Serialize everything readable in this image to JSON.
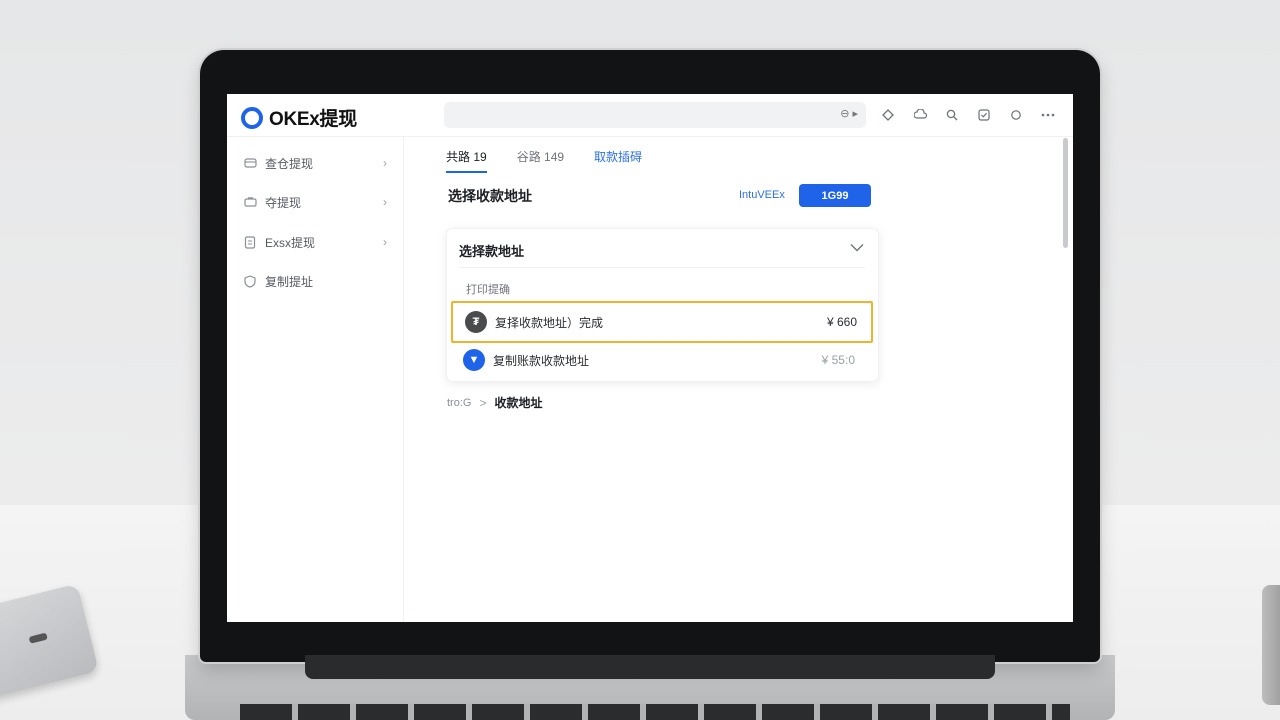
{
  "app": {
    "title": "OKEx提现"
  },
  "topbar": {
    "search_hint": "⊖ ▸",
    "icons": [
      "diamond-icon",
      "cloud-icon",
      "search-icon",
      "checkbox-icon",
      "circle-icon",
      "more-icon"
    ]
  },
  "sidebar": {
    "items": [
      {
        "label": "查仓提现",
        "icon": "wallet-icon"
      },
      {
        "label": "夺提现",
        "icon": "briefcase-icon"
      },
      {
        "label": "Exsx提现",
        "icon": "document-icon"
      },
      {
        "label": "复制提址",
        "icon": "shield-icon"
      }
    ]
  },
  "tabs": [
    {
      "label": "共路 19"
    },
    {
      "label": "谷路 149"
    },
    {
      "label": "取款插碍"
    }
  ],
  "main": {
    "title": "选择收款地址",
    "link_label": "IntuVEEx",
    "primary_button": "1G99"
  },
  "card": {
    "heading": "选择款地址",
    "subheading": "打印提确",
    "options": [
      {
        "label": "复择收款地址）完成",
        "amount": "¥ 660",
        "coin_color": "#4a4b4d"
      },
      {
        "label": "复制账款收款地址",
        "amount": "¥ 55:0",
        "coin_color": "#1f63e8"
      }
    ]
  },
  "breadcrumb": {
    "first": "tro:G",
    "separator": ">",
    "current": "收款地址"
  },
  "colors": {
    "accent": "#1f63e8",
    "highlight": "#f0b233"
  }
}
